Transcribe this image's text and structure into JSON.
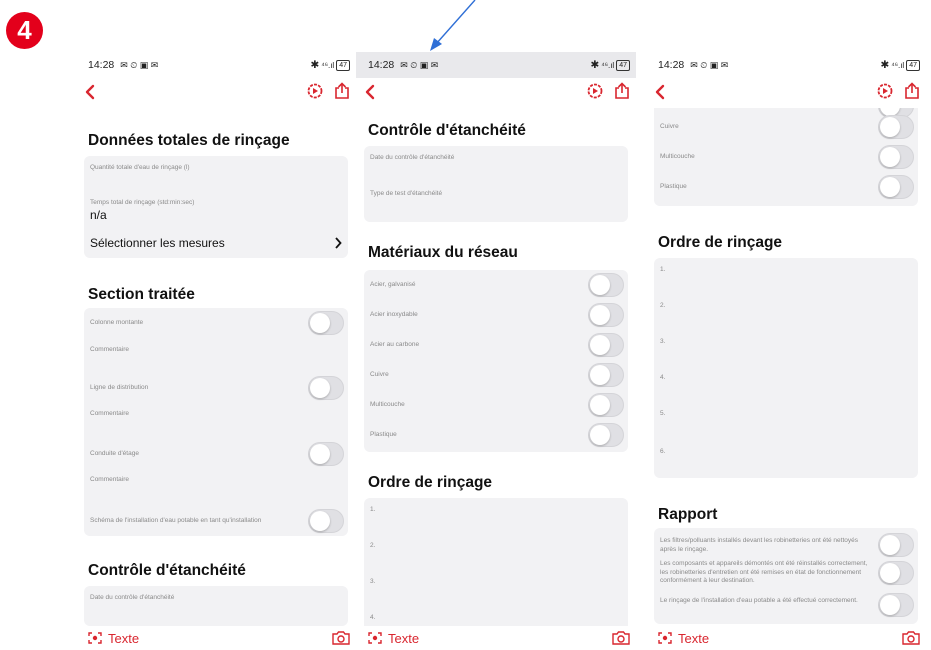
{
  "step_number": "4",
  "status_time": "14:28",
  "status_icons_left": "✉ ⏲ ▣ ✉",
  "network": "⁴⁶.ıl",
  "battery": "47",
  "colors": {
    "accent": "#d9262f",
    "badge": "#e3001b",
    "card": "#f2f2f4",
    "arrow": "#2f6fd6"
  },
  "bottom_bar": {
    "text_label": "Texte"
  },
  "screen1": {
    "totals_title": "Données totales de rinçage",
    "total_water_label": "Quantité totale d'eau de rinçage (l)",
    "total_time_label": "Temps total de rinçage (std:min:sec)",
    "total_time_value": "n/a",
    "select_measures": "Sélectionner les mesures",
    "section_title": "Section traitée",
    "rows": [
      {
        "label": "Colonne montante",
        "comment": "Commentaire"
      },
      {
        "label": "Ligne de distribution",
        "comment": "Commentaire"
      },
      {
        "label": "Conduite d'étage",
        "comment": "Commentaire"
      },
      {
        "label": "Schéma de l'installation d'eau potable en tant qu'installation"
      }
    ],
    "leak_title": "Contrôle d'étanchéité",
    "leak_date_label": "Date du contrôle d'étanchéité"
  },
  "screen2": {
    "leak_title": "Contrôle d'étanchéité",
    "leak_date_label": "Date du contrôle d'étanchéité",
    "leak_type_label": "Type de test d'étanchéité",
    "materials_title": "Matériaux du réseau",
    "materials": [
      "Acier, galvanisé",
      "Acier inoxydable",
      "Acier au carbone",
      "Cuivre",
      "Multicouche",
      "Plastique"
    ],
    "order_title": "Ordre de rinçage",
    "order_items": [
      "1.",
      "2.",
      "3.",
      "4."
    ]
  },
  "screen3": {
    "materials_partial": [
      "Cuivre",
      "Multicouche",
      "Plastique"
    ],
    "order_title": "Ordre de rinçage",
    "order_items": [
      "1.",
      "2.",
      "3.",
      "4.",
      "5.",
      "6."
    ],
    "report_title": "Rapport",
    "report_items": [
      "Les filtres/polluants installés devant les robinetteries ont été nettoyés après le rinçage.",
      "Les composants et appareils démontés ont été réinstallés correctement, les robinetteries d'entretien ont été remises en état de fonctionnement conformément à leur destination.",
      "Le rinçage de l'installation d'eau potable a été effectué correctement."
    ]
  }
}
